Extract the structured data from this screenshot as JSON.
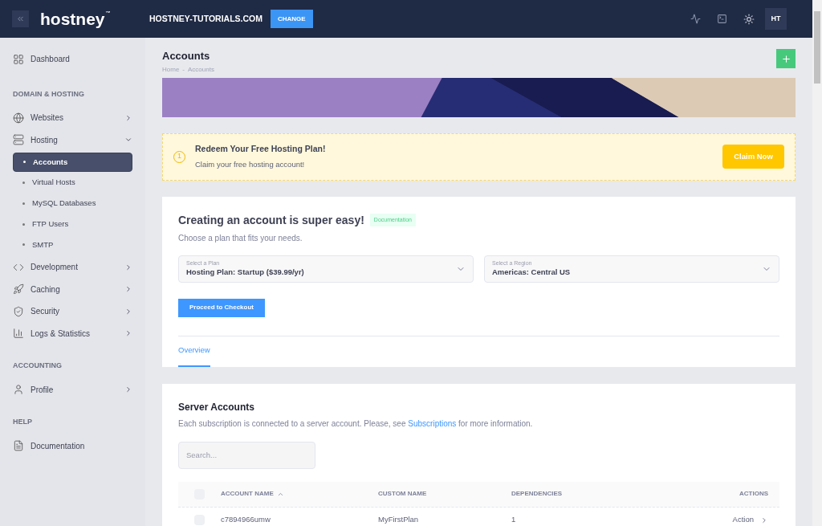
{
  "header": {
    "logo": "hostney",
    "trademark": "™",
    "domain": "HOSTNEY-TUTORIALS.COM",
    "change_button": "CHANGE",
    "avatar": "HT"
  },
  "sidebar": {
    "items": [
      {
        "kind": "link",
        "label": "Dashboard"
      },
      {
        "kind": "heading",
        "label": "DOMAIN & HOSTING"
      },
      {
        "kind": "group",
        "label": "Websites",
        "expanded": false
      },
      {
        "kind": "group",
        "label": "Hosting",
        "expanded": true,
        "children": [
          {
            "label": "Accounts",
            "selected": true
          },
          {
            "label": "Virtual Hosts",
            "selected": false
          },
          {
            "label": "MySQL Databases",
            "selected": false
          },
          {
            "label": "FTP Users",
            "selected": false
          },
          {
            "label": "SMTP",
            "selected": false
          }
        ]
      },
      {
        "kind": "group",
        "label": "Development",
        "expanded": false
      },
      {
        "kind": "group",
        "label": "Caching",
        "expanded": false
      },
      {
        "kind": "group",
        "label": "Security",
        "expanded": false
      },
      {
        "kind": "group",
        "label": "Logs & Statistics",
        "expanded": false
      },
      {
        "kind": "heading",
        "label": "ACCOUNTING"
      },
      {
        "kind": "group",
        "label": "Profile",
        "expanded": false
      },
      {
        "kind": "heading",
        "label": "HELP"
      },
      {
        "kind": "link",
        "label": "Documentation"
      }
    ]
  },
  "page": {
    "title": "Accounts",
    "breadcrumb": [
      "Home",
      "Accounts"
    ],
    "breadcrumb_separator": "-"
  },
  "notice": {
    "icon_text": "1",
    "title": "Redeem Your Free Hosting Plan!",
    "text": "Claim your free hosting account!",
    "button": "Claim Now"
  },
  "create": {
    "title": "Creating an account is super easy!",
    "badge": "Documentation",
    "subtitle": "Choose a plan that fits your needs.",
    "selects": [
      {
        "label": "Select a Plan",
        "value": "Hosting Plan: Startup ($39.99/yr)"
      },
      {
        "label": "Select a Region",
        "value": "Americas: Central US"
      }
    ],
    "button": "Proceed to Checkout",
    "tabs": [
      {
        "label": "Overview",
        "selected": true
      }
    ]
  },
  "server_accounts": {
    "title": "Server Accounts",
    "text_before": "Each subscription is connected to a server account. Please, see",
    "link": "Subscriptions",
    "text_after": "for more information.",
    "search_placeholder": "Search...",
    "table": {
      "all_checked": false,
      "columns": [
        {
          "label": "ACCOUNT NAME",
          "sorted": true
        },
        {
          "label": "CUSTOM NAME",
          "sorted": false
        },
        {
          "label": "DEPENDENCIES",
          "sorted": false
        },
        {
          "label": "ACTIONS",
          "sorted": false
        }
      ],
      "rows": [
        {
          "checked": false,
          "cells": [
            "c7894966umw",
            "MyFirstPlan",
            "1",
            "Action"
          ]
        }
      ]
    }
  }
}
